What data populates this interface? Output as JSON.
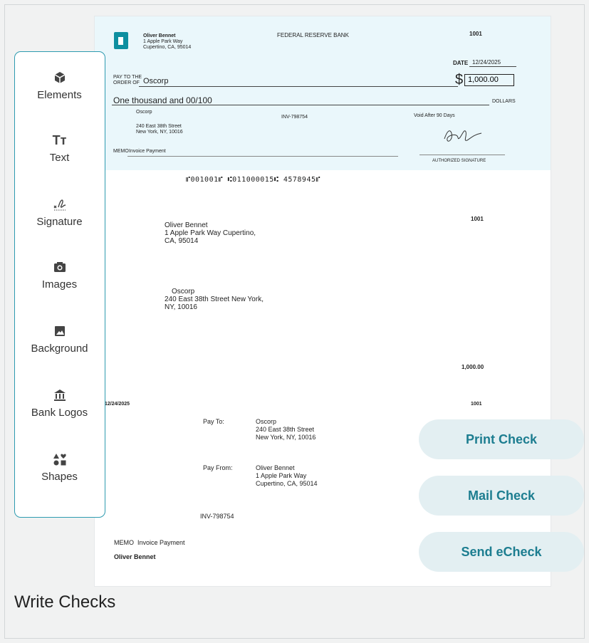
{
  "page": {
    "title": "Write Checks"
  },
  "sidebar": {
    "items": [
      {
        "label": "Elements",
        "icon": "cube-icon"
      },
      {
        "label": "Text",
        "icon": "text-icon"
      },
      {
        "label": "Signature",
        "icon": "signature-icon"
      },
      {
        "label": "Images",
        "icon": "camera-icon"
      },
      {
        "label": "Background",
        "icon": "image-icon"
      },
      {
        "label": "Bank Logos",
        "icon": "bank-icon"
      },
      {
        "label": "Shapes",
        "icon": "shapes-icon"
      }
    ]
  },
  "check": {
    "payer_name": "Oliver Bennet",
    "payer_address1": "1 Apple Park Way",
    "payer_address2": "Cupertino, CA, 95014",
    "bank": "FEDERAL RESERVE BANK",
    "number": "1001",
    "date_label": "DATE",
    "date": "12/24/2025",
    "pay_to_line1": "PAY TO THE",
    "pay_to_line2": "ORDER OF",
    "payee": "Oscorp",
    "dollar_sign": "$",
    "amount": "1,000.00",
    "amount_words": "One thousand and 00/100",
    "dollars_label": "DOLLARS",
    "payee_name_small": "Oscorp",
    "payee_address1": "240 East 38th Street",
    "payee_address2": "New York, NY, 10016",
    "invoice": "INV-798754",
    "void_text": "Void After 90 Days",
    "memo_label": "MEMO",
    "memo": "Invoice Payment",
    "auth_sig": "AUTHORIZED SIGNATURE",
    "micr": "⑈001001⑈ ⑆011000015⑆ 4578945⑈"
  },
  "stub": {
    "number": "1001",
    "payer_addr_line1": "Oliver Bennet",
    "payer_addr_line2": "1 Apple Park Way Cupertino,",
    "payer_addr_line3": "CA, 95014",
    "payee_addr_line1": "Oscorp",
    "payee_addr_line2": "240 East 38th Street New York,",
    "payee_addr_line3": "NY, 10016",
    "amount": "1,000.00",
    "date": "12/24/2025",
    "number2": "1001",
    "pay_to_label": "Pay To:",
    "pay_to_1": "Oscorp",
    "pay_to_2": "240 East 38th Street",
    "pay_to_3": "New York, NY, 10016",
    "pay_from_label": "Pay From:",
    "pay_from_1": "Oliver Bennet",
    "pay_from_2": "1 Apple Park Way",
    "pay_from_3": "Cupertino, CA, 95014",
    "invoice": "INV-798754",
    "memo_label": "MEMO",
    "memo": "Invoice Payment",
    "signer": "Oliver Bennet"
  },
  "actions": {
    "print": "Print Check",
    "mail": "Mail Check",
    "send": "Send eCheck"
  },
  "colors": {
    "accent": "#1c7d90",
    "check_bg": "#eaf7fb",
    "button_bg": "#e3eff2",
    "sidebar_border": "#2e9bb0"
  }
}
